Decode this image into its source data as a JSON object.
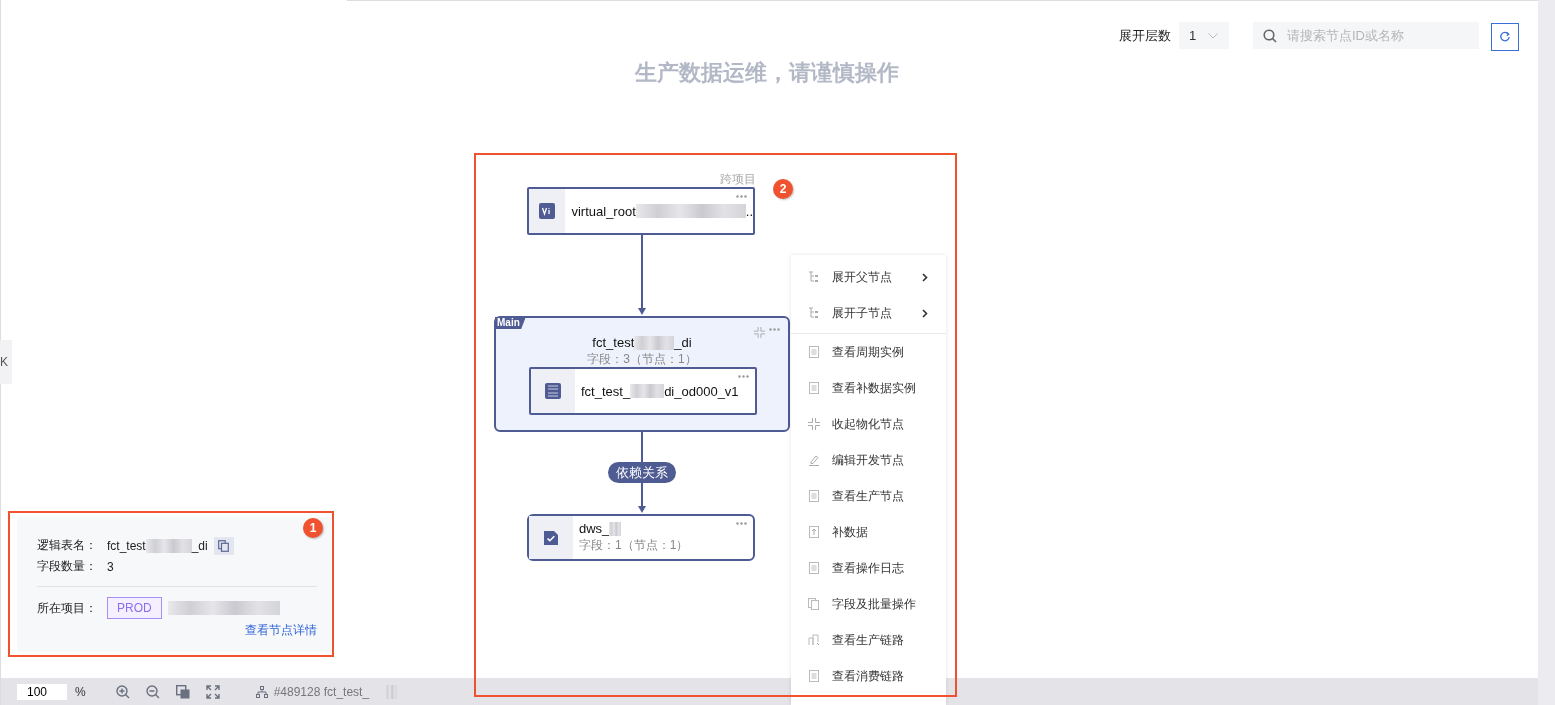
{
  "toolbar": {
    "levels_label": "展开层数",
    "levels_value": "1",
    "search": {
      "placeholder": "请搜索节点ID或名称"
    }
  },
  "banner": "生产数据运维，请谨慎操作",
  "side_tab": "K",
  "graph": {
    "cross_project_label": "跨项目",
    "top_node": {
      "kind": "virtual",
      "name_start": "virtual_root",
      "redacted": true,
      "name_end": ".."
    },
    "group": {
      "tag": "Main",
      "name_start": "fct_test",
      "redacted": true,
      "name_end": "_di",
      "subtitle": "字段：3（节点：1）",
      "node": {
        "kind": "mysql",
        "name_start": "fct_test_",
        "redacted": true,
        "name_end": "di_od000_v1"
      }
    },
    "edge_label": "依赖关系",
    "bottom_node": {
      "kind": "check",
      "name_start": "dws_",
      "redacted": true,
      "subtitle": "字段：1（节点：1）"
    }
  },
  "context_menu": {
    "items": [
      {
        "label": "展开父节点",
        "submenu": true
      },
      {
        "label": "展开子节点",
        "submenu": true
      },
      {
        "label": "查看周期实例",
        "submenu": false
      },
      {
        "label": "查看补数据实例",
        "submenu": false
      },
      {
        "label": "收起物化节点",
        "submenu": false
      },
      {
        "label": "编辑开发节点",
        "submenu": false
      },
      {
        "label": "查看生产节点",
        "submenu": false
      },
      {
        "label": "补数据",
        "submenu": false
      },
      {
        "label": "查看操作日志",
        "submenu": false
      },
      {
        "label": "字段及批量操作",
        "submenu": false
      },
      {
        "label": "查看生产链路",
        "submenu": false
      },
      {
        "label": "查看消费链路",
        "submenu": false
      }
    ]
  },
  "info_panel": {
    "rows": [
      {
        "label": "逻辑表名：",
        "value_start": "fct_test",
        "redacted": true,
        "value_end": "_di",
        "copy": true
      },
      {
        "label": "字段数量：",
        "value_start": "3",
        "redacted": false,
        "copy": false
      }
    ],
    "project_label": "所在项目：",
    "project_tag": "PROD",
    "project_redacted": true,
    "link": "查看节点详情"
  },
  "footer": {
    "zoom": "100",
    "zoom_unit": "%",
    "node_ref": "#489128 fct_test_",
    "node_ref_redacted": true
  },
  "annotations": [
    {
      "label": "1"
    },
    {
      "label": "2"
    }
  ]
}
